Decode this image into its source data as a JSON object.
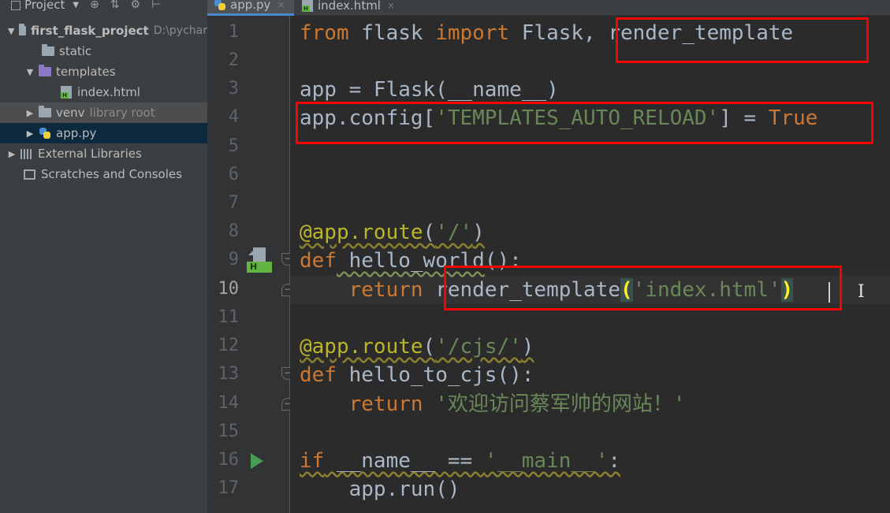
{
  "project_panel": {
    "title": "Project",
    "toolbar_icons": [
      "target-icon",
      "collapse-icon",
      "gear-icon",
      "pin-icon"
    ],
    "tree": {
      "root": {
        "name": "first_flask_project",
        "path": "D:\\pychar"
      },
      "static": "static",
      "templates": "templates",
      "index_html": "index.html",
      "venv": {
        "name": "venv",
        "hint": "library root"
      },
      "app_py": "app.py",
      "external_libraries": "External Libraries",
      "scratches": "Scratches and Consoles"
    }
  },
  "editor": {
    "tabs": [
      {
        "label": "app.py",
        "active": true,
        "close": "×"
      },
      {
        "label": "index.html",
        "active": false,
        "close": "×"
      }
    ],
    "line_numbers": [
      "1",
      "2",
      "3",
      "4",
      "5",
      "6",
      "7",
      "8",
      "9",
      "10",
      "11",
      "12",
      "13",
      "14",
      "15",
      "16",
      "17"
    ],
    "current_line": "10",
    "code": {
      "l1": {
        "kw1": "from",
        "mod": " flask ",
        "kw2": "import",
        "names": " Flask, render_template"
      },
      "l3": {
        "text": "app = Flask(__name__)"
      },
      "l4": {
        "pre": "app.config[",
        "str": "'TEMPLATES_AUTO_RELOAD'",
        "mid": "] = ",
        "val": "True"
      },
      "l8": {
        "deco": "@app.route",
        "open": "(",
        "str": "'/'",
        "close": ")"
      },
      "l9": {
        "kw": "def",
        "name": " hello_world",
        "rest": "():"
      },
      "l10": {
        "indent": "    ",
        "kw": "return",
        "fn": " render_template",
        "open": "(",
        "str": "'index.html'",
        "close": ")"
      },
      "l12": {
        "deco": "@app.route",
        "open": "(",
        "str": "'/cjs/'",
        "close": ")"
      },
      "l13": {
        "kw": "def",
        "name": " hello_to_cjs",
        "rest": "():"
      },
      "l14": {
        "indent": "    ",
        "kw": "return",
        "str": " '欢迎访问蔡军帅的网站！'"
      },
      "l16": {
        "kw": "if",
        "mid": " __name__ == ",
        "str": "'__main__'",
        "rest": ":"
      },
      "l17": {
        "indent": "    ",
        "text": "app.run()"
      }
    },
    "gutter_badge": "H"
  },
  "colors": {
    "background": "#2b2b2b",
    "keyword": "#cc7832",
    "string": "#6a8759",
    "decorator": "#bbb529",
    "plain": "#a9b7c6",
    "annotation_box": "#ff0000"
  }
}
